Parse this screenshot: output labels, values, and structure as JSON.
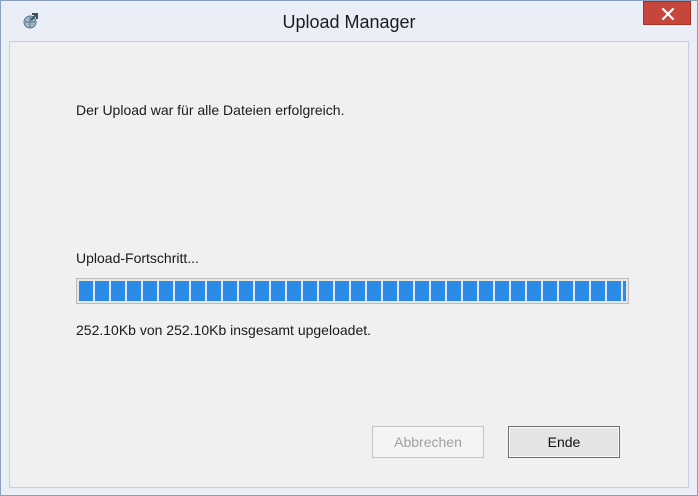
{
  "window": {
    "title": "Upload Manager",
    "accent_color": "#c7463b",
    "icon": "upload-globe-icon",
    "close_icon": "close-icon"
  },
  "message": "Der Upload war für alle Dateien erfolgreich.",
  "progress": {
    "label": "Upload-Fortschritt...",
    "percent": 100,
    "color": "#2a8ce6",
    "summary": "252.10Kb von 252.10Kb insgesamt upgeloadet."
  },
  "buttons": {
    "cancel": "Abbrechen",
    "end": "Ende"
  }
}
